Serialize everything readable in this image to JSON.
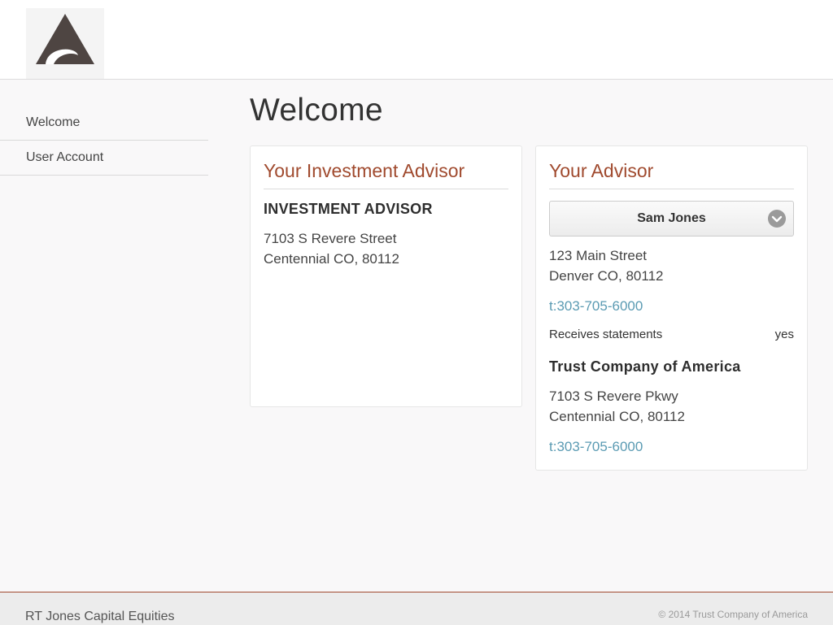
{
  "nav": {
    "items": [
      {
        "label": "Welcome"
      },
      {
        "label": "User Account"
      }
    ]
  },
  "page": {
    "title": "Welcome"
  },
  "investment_advisor_card": {
    "title": "Your Investment Advisor",
    "name": "INVESTMENT ADVISOR",
    "address_line1": "7103 S Revere Street",
    "address_line2": "Centennial CO, 80112"
  },
  "advisor_card": {
    "title": "Your Advisor",
    "selected_advisor": "Sam Jones",
    "address_line1": "123 Main Street",
    "address_line2": "Denver CO, 80112",
    "phone": "t:303-705-6000",
    "statements_label": "Receives statements",
    "statements_value": "yes",
    "company_name": "Trust Company of America",
    "company_address_line1": "7103 S Revere Pkwy",
    "company_address_line2": "Centennial CO, 80112",
    "company_phone": "t:303-705-6000"
  },
  "footer": {
    "company": "RT Jones Capital Equities",
    "copyright": "© 2014 Trust Company of America"
  },
  "colors": {
    "accent": "#a04a2e",
    "link": "#5b9bb3",
    "logo": "#4e4542"
  }
}
